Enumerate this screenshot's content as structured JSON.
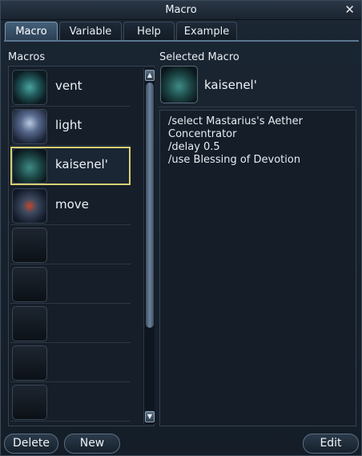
{
  "window": {
    "title": "Macro",
    "close_glyph": "✕"
  },
  "tabs": [
    {
      "label": "Macro",
      "active": true
    },
    {
      "label": "Variable",
      "active": false
    },
    {
      "label": "Help",
      "active": false
    },
    {
      "label": "Example",
      "active": false
    }
  ],
  "macros": {
    "header": "Macros",
    "items": [
      {
        "name": "vent",
        "icon": "vent-icon"
      },
      {
        "name": "light",
        "icon": "light-icon"
      },
      {
        "name": "kaisenel'",
        "icon": "kaisenel-icon",
        "selected": true
      },
      {
        "name": "move",
        "icon": "move-icon"
      },
      {
        "name": "",
        "icon": "empty-slot"
      },
      {
        "name": "",
        "icon": "empty-slot"
      },
      {
        "name": "",
        "icon": "empty-slot"
      },
      {
        "name": "",
        "icon": "empty-slot"
      },
      {
        "name": "",
        "icon": "empty-slot"
      }
    ],
    "scroll_up_glyph": "▲",
    "scroll_down_glyph": "▼"
  },
  "selected": {
    "header": "Selected Macro",
    "name": "kaisenel'",
    "lines": [
      "/select Mastarius's Aether Concentrator",
      "/delay 0.5",
      "/use Blessing of Devotion"
    ]
  },
  "buttons": {
    "delete": "Delete",
    "new": "New",
    "edit": "Edit"
  },
  "colors": {
    "selected_border": "#d8cf72",
    "active_tab": "#44607a"
  }
}
